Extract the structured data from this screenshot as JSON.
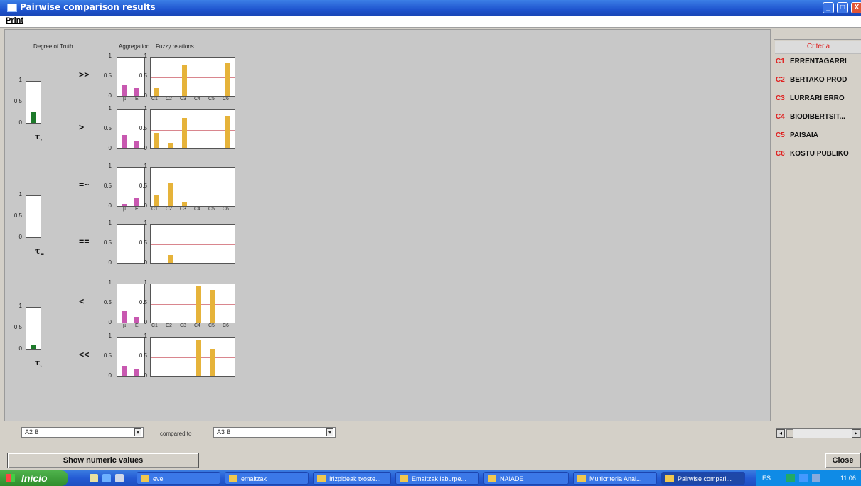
{
  "window": {
    "title": "Pairwise comparison results",
    "min_label": "_",
    "max_label": "□",
    "close_label": "X"
  },
  "menu": {
    "print": "Print"
  },
  "headers": {
    "degree_of_truth": "Degree of Truth",
    "aggregation": "Aggregation",
    "fuzzy_relations": "Fuzzy relations"
  },
  "axis_ticks": {
    "one": "1",
    "half": "0.5",
    "zero": "0"
  },
  "agg_xlabels": {
    "mu": "µ",
    "e": "E"
  },
  "fuzzy_xlabels": [
    "C1",
    "C2",
    "C3",
    "C4",
    "C5",
    "C6"
  ],
  "truth": [
    {
      "tau": "τ",
      "sub": "›",
      "value": 0.25
    },
    {
      "tau": "τ",
      "sub": "=",
      "value": 0.0
    },
    {
      "tau": "τ",
      "sub": "‹",
      "value": 0.1
    }
  ],
  "relations": [
    {
      "symbol": ">>",
      "agg": [
        0.3,
        0.2
      ],
      "fuzzy": [
        0.2,
        0,
        0.8,
        0,
        0,
        0.85
      ]
    },
    {
      "symbol": ">",
      "agg": [
        0.35,
        0.18
      ],
      "fuzzy": [
        0.4,
        0.15,
        0.8,
        0,
        0,
        0.85
      ]
    },
    {
      "symbol": "=~",
      "agg": [
        0.05,
        0.2
      ],
      "fuzzy": [
        0.3,
        0.6,
        0.1,
        0,
        0,
        0
      ]
    },
    {
      "symbol": "==",
      "agg": [
        0,
        0
      ],
      "fuzzy": [
        0,
        0.2,
        0,
        0,
        0,
        0
      ]
    },
    {
      "symbol": "<",
      "agg": [
        0.3,
        0.15
      ],
      "fuzzy": [
        0,
        0,
        0,
        0.95,
        0.85,
        0
      ]
    },
    {
      "symbol": "<<",
      "agg": [
        0.25,
        0.18
      ],
      "fuzzy": [
        0,
        0,
        0,
        0.95,
        0.7,
        0
      ]
    }
  ],
  "colors": {
    "agg_bar": "#c858b0",
    "fuzzy_bar": "#e6b33a",
    "truth_bar": "#1d7a2a",
    "threshold": "#d9868e"
  },
  "criteria": {
    "title": "Criteria",
    "items": [
      {
        "code": "C1",
        "label": "ERRENTAGARRI"
      },
      {
        "code": "C2",
        "label": "BERTAKO PROD"
      },
      {
        "code": "C3",
        "label": "LURRARI ERRO"
      },
      {
        "code": "C4",
        "label": "BIODIBERTSIT..."
      },
      {
        "code": "C5",
        "label": "PAISAIA"
      },
      {
        "code": "C6",
        "label": "KOSTU PUBLIKO"
      }
    ]
  },
  "selectors": {
    "left": "A2 B",
    "compared_to": "compared to",
    "right": "A3 B"
  },
  "buttons": {
    "show_numeric": "Show numeric values",
    "close": "Close"
  },
  "taskbar": {
    "start": "Inicio",
    "tasks": [
      "eve",
      "emaitzak",
      "Irizpideak txoste...",
      "Emaitzak laburpe...",
      "NAIADE",
      "Multicriteria Anal...",
      "Pairwise compari..."
    ],
    "tray": "ES",
    "clock": "11:06"
  }
}
